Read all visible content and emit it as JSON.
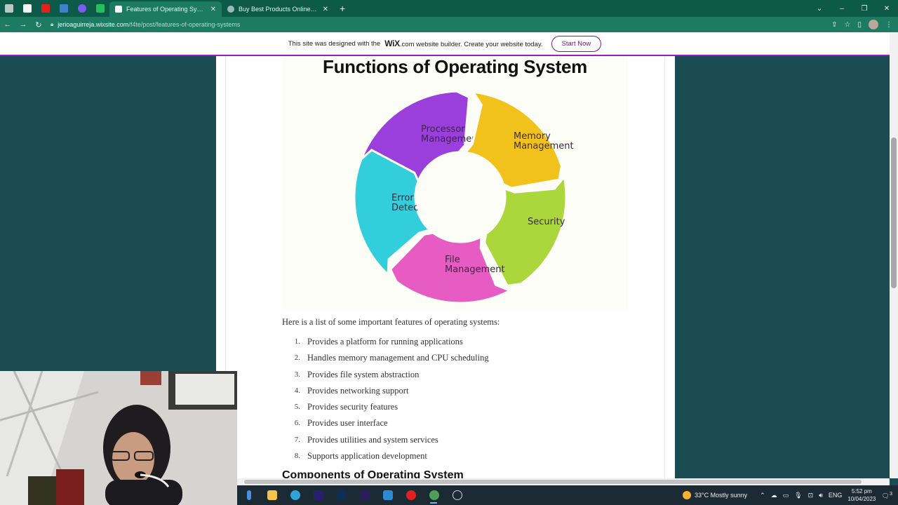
{
  "browser": {
    "tabs": [
      {
        "title": "Features of Operating Systems",
        "active": true
      },
      {
        "title": "Buy Best Products Online - Shop",
        "active": false
      }
    ],
    "url_host": "jerioaguirreja.wixsite.com",
    "url_path": "/f4te/post/features-of-operating-systems"
  },
  "wix_banner": {
    "text_before": "This site was designed with the",
    "brand": "WiX",
    "text_after": ".com website builder. Create your website today.",
    "button": "Start Now"
  },
  "figure": {
    "title": "Functions of Operating System",
    "segments": [
      {
        "line1": "Processor",
        "line2": "Management",
        "color": "#9a3fdc"
      },
      {
        "line1": "Memory",
        "line2": "Management",
        "color": "#f2c21c"
      },
      {
        "line1": "Security",
        "line2": "",
        "color": "#abd63c"
      },
      {
        "line1": "File",
        "line2": "Management",
        "color": "#e75cc3"
      },
      {
        "line1": "Error",
        "line2": "Detection",
        "color": "#33cedc"
      }
    ]
  },
  "article": {
    "intro": "Here is a list of some important features of operating systems:",
    "features": [
      {
        "num": "1.",
        "text": "Provides a platform for running applications"
      },
      {
        "num": "2.",
        "text": "Handles memory management and CPU scheduling"
      },
      {
        "num": "3.",
        "text": "Provides file system abstraction"
      },
      {
        "num": "4.",
        "text": "Provides networking support"
      },
      {
        "num": "5.",
        "text": "Provides security features"
      },
      {
        "num": "6.",
        "text": "Provides user interface"
      },
      {
        "num": "7.",
        "text": "Provides utilities and system services"
      },
      {
        "num": "8.",
        "text": "Supports application development"
      }
    ],
    "next_heading": "Components of Operating System"
  },
  "taskbar": {
    "weather": "33°C  Mostly sunny",
    "lang": "ENG",
    "time": "5:52 pm",
    "date": "10/04/2023",
    "notifications": "3"
  }
}
